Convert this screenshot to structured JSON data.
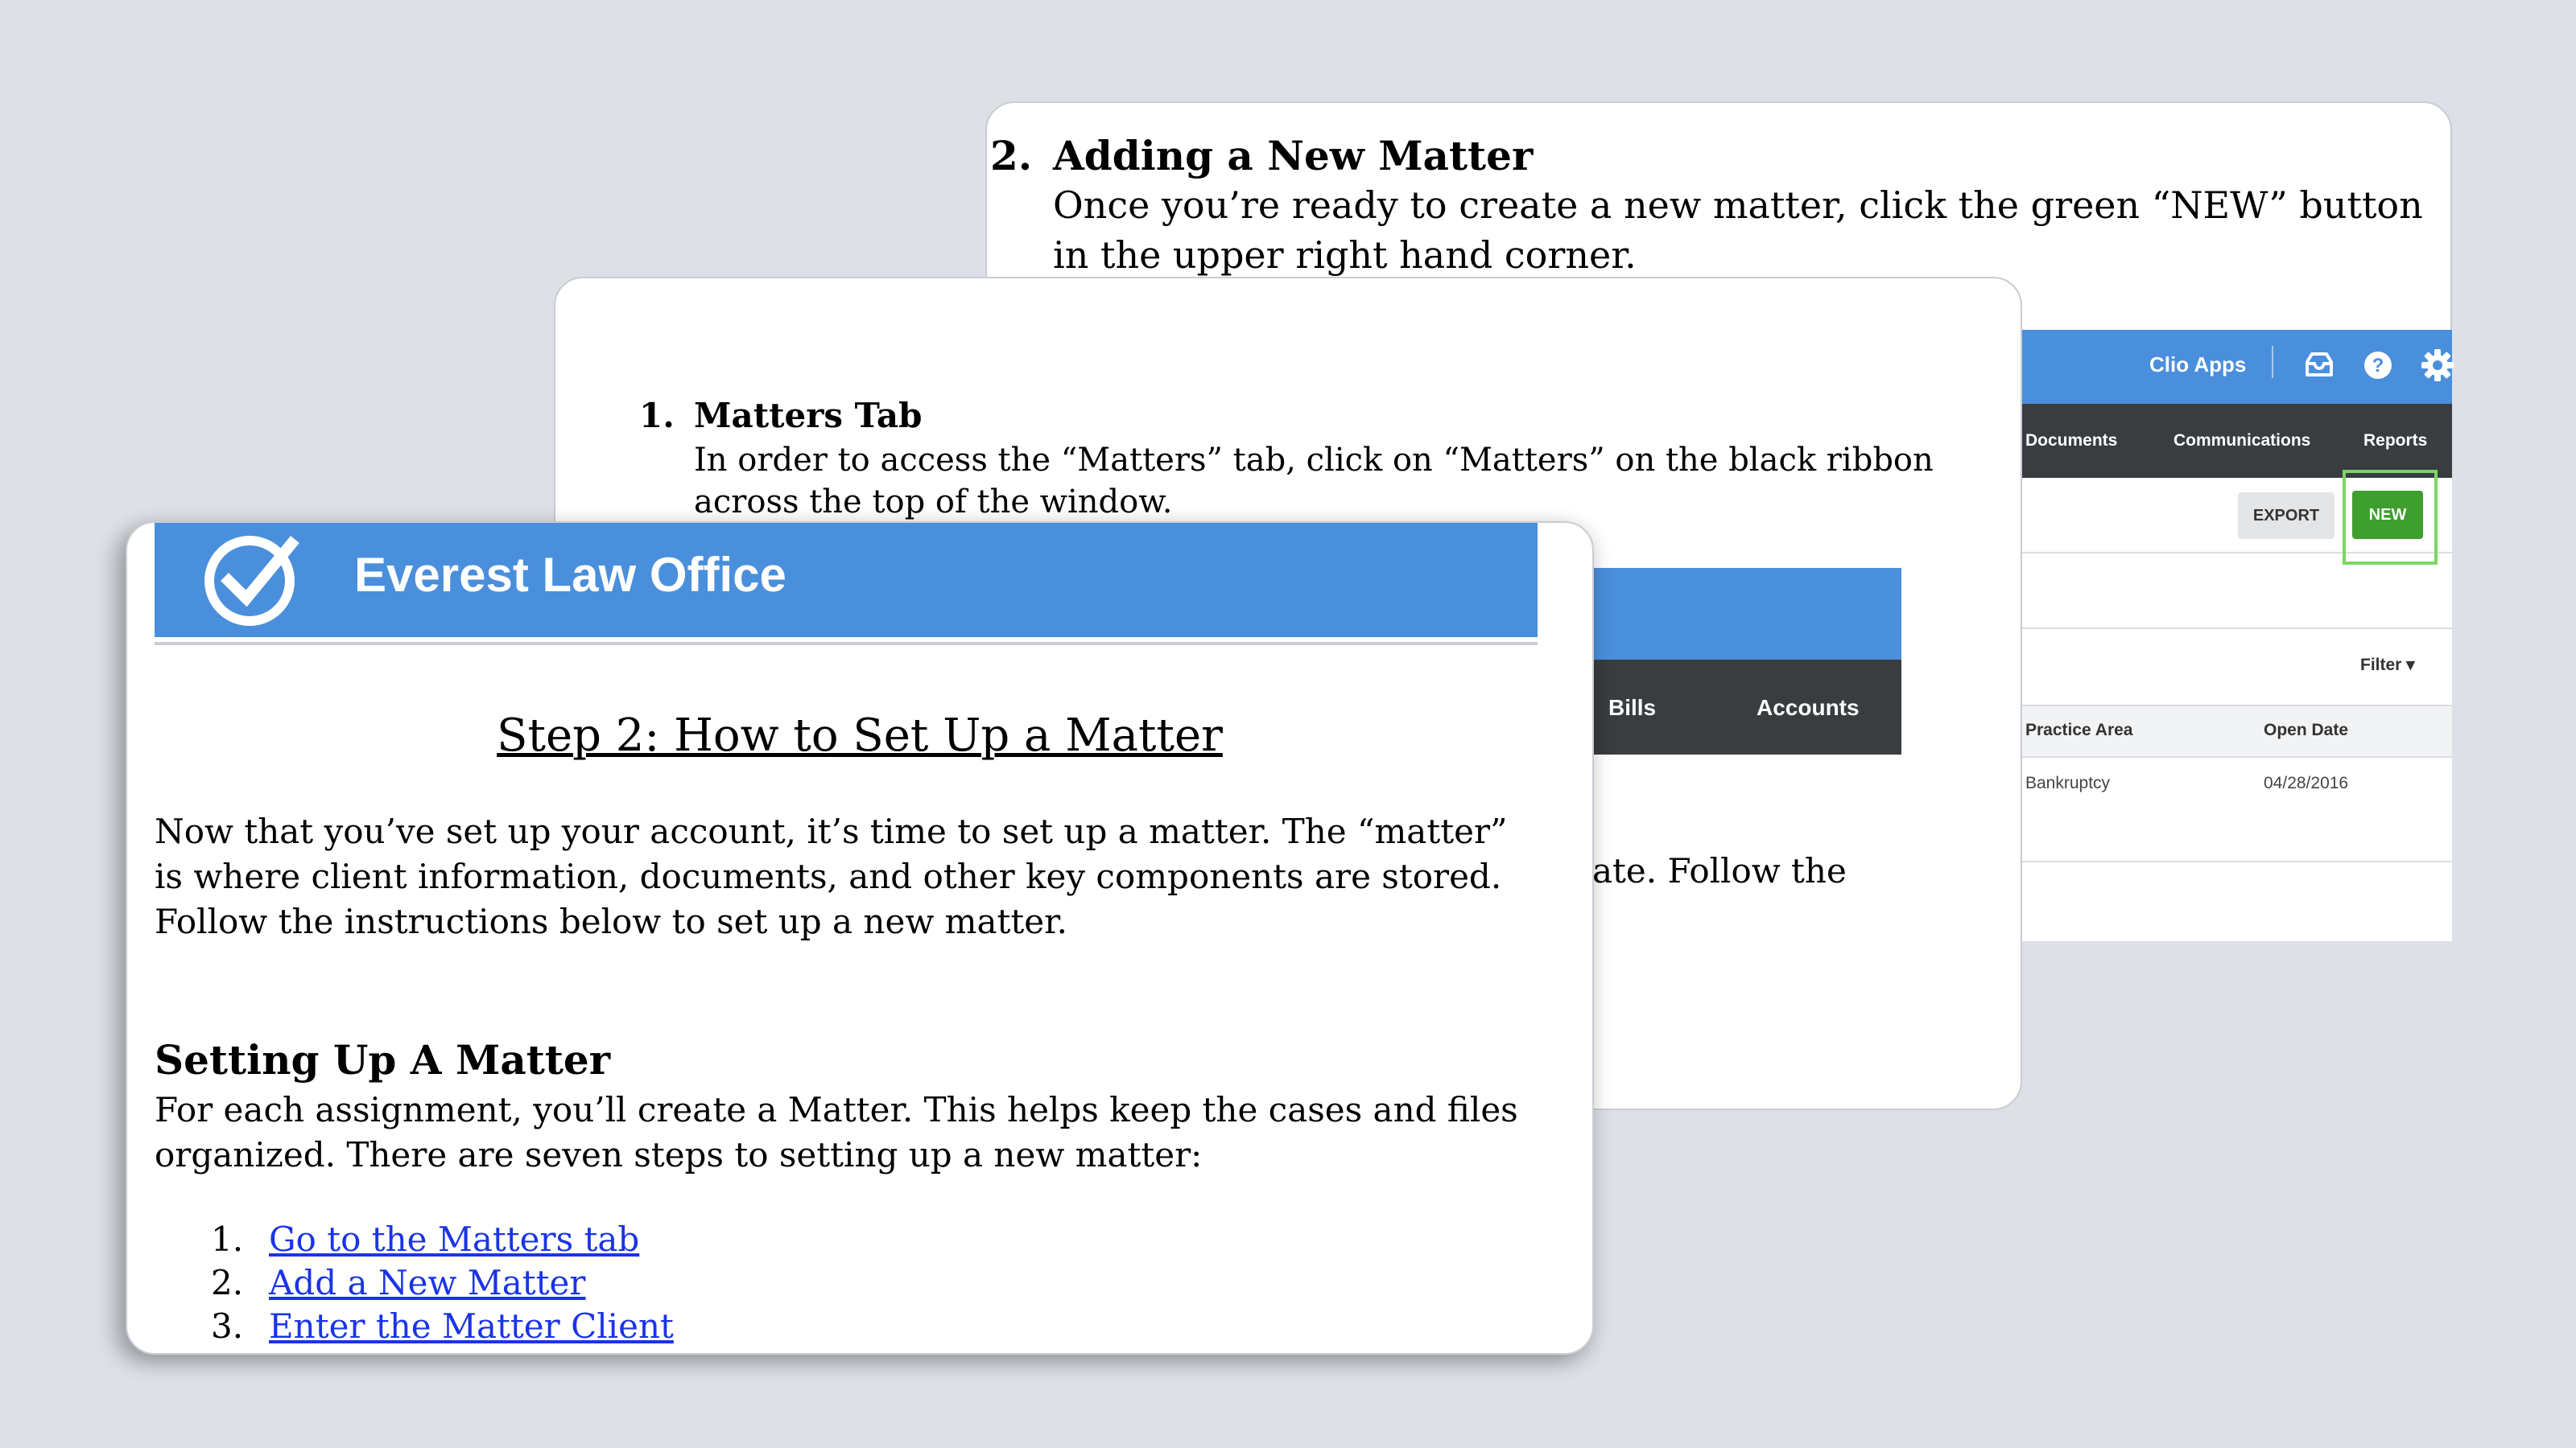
{
  "card3": {
    "number": "2.",
    "heading": "Adding a New Matter",
    "body": "Once you’re ready to create a new matter, click the green “NEW” button in the upper right hand corner.",
    "app": {
      "header_apps": "Clio Apps",
      "nav": [
        "Documents",
        "Communications",
        "Reports"
      ],
      "export_label": "EXPORT",
      "new_label": "NEW",
      "filter_label": "Filter ▾",
      "columns": [
        "Practice Area",
        "Open Date"
      ],
      "row": [
        "Bankruptcy",
        "04/28/2016"
      ],
      "accent": "#4a8fdc",
      "new_color": "#3e9e2e"
    }
  },
  "card2": {
    "number": "1.",
    "heading": "Matters Tab",
    "body": "In order to access the “Matters” tab, click on “Matters” on the black ribbon across the top of the window.",
    "nav": [
      "Bills",
      "Accounts"
    ],
    "continuation": "ate.  Follow the"
  },
  "card1": {
    "org_name": "Everest Law Office",
    "title": "Step 2: How to Set Up a Matter",
    "intro": "Now that you’ve set up your account, it’s time to set up a matter.  The “matter” is where client information, documents, and other key components are stored.  Follow the instructions below to set up a new matter.",
    "section_heading": "Setting Up A Matter",
    "section_body": "For each assignment, you’ll create a Matter.  This helps keep the cases and files organized. There are seven steps to setting up a new matter:",
    "steps": [
      {
        "num": "1.",
        "label": "Go to the Matters tab"
      },
      {
        "num": "2.",
        "label": "Add a New Matter"
      },
      {
        "num": "3.",
        "label": "Enter the Matter Client"
      }
    ],
    "banner_color": "#4a8fdc",
    "link_color": "#1a34e6"
  }
}
